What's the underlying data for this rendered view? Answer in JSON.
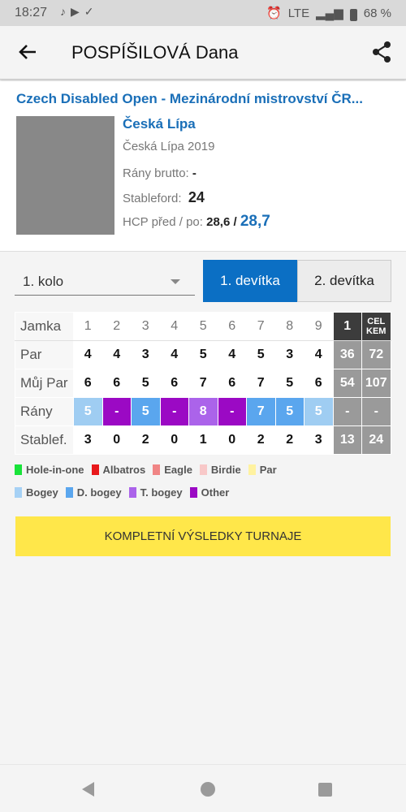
{
  "status_bar": {
    "time": "18:27",
    "network": "LTE",
    "battery": "68 %"
  },
  "app_bar": {
    "title": "POSPÍŠILOVÁ Dana"
  },
  "tournament": {
    "title": "Czech Disabled Open - Mezinárodní mistrovství ČR...",
    "club": "Česká Lípa",
    "event": "Česká Lípa 2019",
    "brutto_label": "Rány brutto:",
    "brutto_value": "-",
    "stableford_label": "Stableford:",
    "stableford_value": "24",
    "hcp_label": "HCP před / po:",
    "hcp_before": "28,6",
    "hcp_sep": "/",
    "hcp_after": "28,7"
  },
  "round_select": {
    "value": "1. kolo"
  },
  "halves": [
    {
      "label": "1. devítka",
      "active": true
    },
    {
      "label": "2. devítka",
      "active": false
    }
  ],
  "scorecard": {
    "row_labels": [
      "Jamka",
      "Par",
      "Můj Par",
      "Rány",
      "Stablef."
    ],
    "holes": [
      "1",
      "2",
      "3",
      "4",
      "5",
      "6",
      "7",
      "8",
      "9"
    ],
    "total_labels": [
      "1",
      "CEL KEM"
    ],
    "par": [
      "4",
      "4",
      "3",
      "4",
      "5",
      "4",
      "5",
      "3",
      "4"
    ],
    "par_totals": [
      "36",
      "72"
    ],
    "my_par": [
      "6",
      "6",
      "5",
      "6",
      "7",
      "6",
      "7",
      "5",
      "6"
    ],
    "my_par_totals": [
      "54",
      "107"
    ],
    "strokes": [
      "5",
      "-",
      "5",
      "-",
      "8",
      "-",
      "7",
      "5",
      "5"
    ],
    "strokes_colors": [
      "#9fcdf2",
      "#9b09c4",
      "#5aa6ee",
      "#9b09c4",
      "#ab63ea",
      "#9b09c4",
      "#5aa6ee",
      "#5aa6ee",
      "#9fcdf2"
    ],
    "strokes_totals": [
      "-",
      "-"
    ],
    "stableford": [
      "3",
      "0",
      "2",
      "0",
      "1",
      "0",
      "2",
      "2",
      "3"
    ],
    "stableford_totals": [
      "13",
      "24"
    ]
  },
  "legend": [
    {
      "label": "Hole-in-one",
      "color": "#19e33a"
    },
    {
      "label": "Albatros",
      "color": "#e8181b"
    },
    {
      "label": "Eagle",
      "color": "#f08585"
    },
    {
      "label": "Birdie",
      "color": "#f8c8c8"
    },
    {
      "label": "Par",
      "color": "#fff2a0"
    },
    {
      "label": "Bogey",
      "color": "#a6d1f5"
    },
    {
      "label": "D. bogey",
      "color": "#5aa6ee"
    },
    {
      "label": "T. bogey",
      "color": "#ab63ea"
    },
    {
      "label": "Other",
      "color": "#9b09c4"
    }
  ],
  "results_button": {
    "label": "KOMPLETNÍ VÝSLEDKY TURNAJE"
  },
  "accent_color": "#1a6fb8"
}
